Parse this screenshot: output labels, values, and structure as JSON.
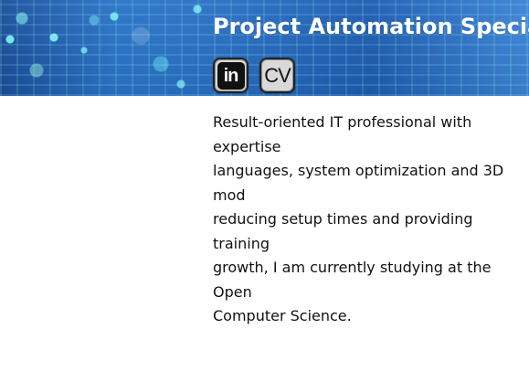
{
  "hero": {
    "title": "Project Automation Special"
  },
  "actions": {
    "linkedin_label": "in",
    "cv_label": "CV"
  },
  "bio": {
    "text": "Result-oriented IT professional with expertise\nlanguages, system optimization and 3D mod\nreducing setup times and providing training\ngrowth, I am currently studying at the Open\nComputer Science."
  },
  "colors": {
    "hero_blue_dark": "#1b4f9b",
    "hero_blue_mid": "#2b74c8",
    "hero_cyan": "#6ff2ff",
    "text_dark": "#111111"
  },
  "icons": {
    "linkedin": "linkedin-icon",
    "cv": "cv-icon"
  }
}
